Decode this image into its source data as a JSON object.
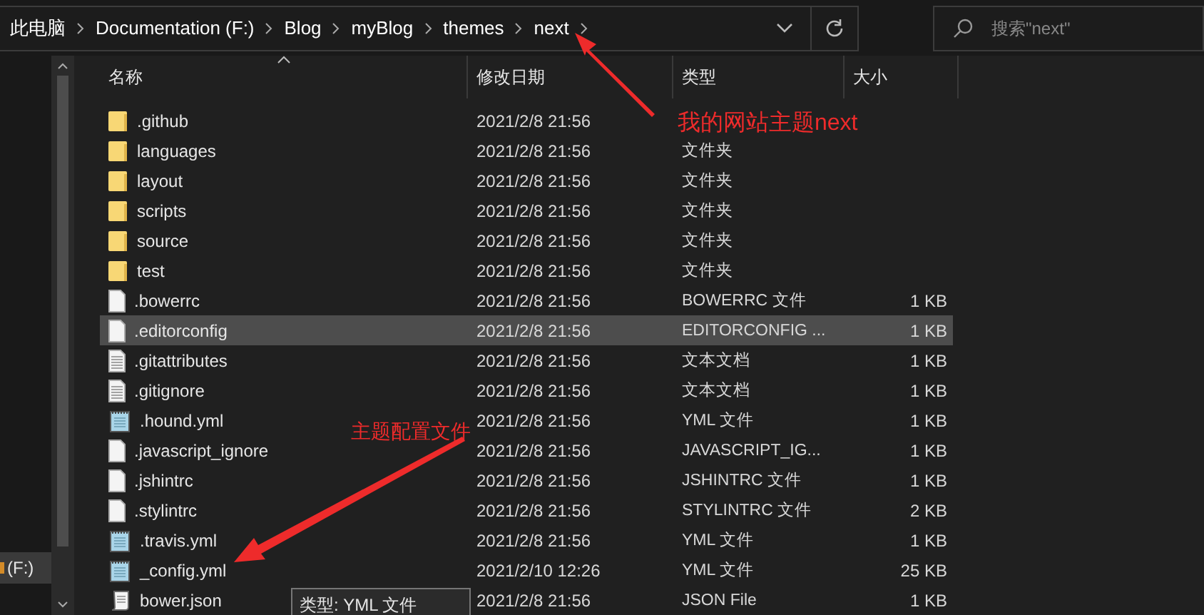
{
  "breadcrumbs": [
    "此电脑",
    "Documentation (F:)",
    "Blog",
    "myBlog",
    "themes",
    "next"
  ],
  "search": {
    "placeholder": "搜索\"next\""
  },
  "nav": {
    "items": [
      {
        "label": "(F:)",
        "selected": true
      }
    ]
  },
  "columns": [
    "名称",
    "修改日期",
    "类型",
    "大小"
  ],
  "files": [
    {
      "name": ".github",
      "date": "2021/2/8 21:56",
      "kind": "folder",
      "selected": false
    },
    {
      "name": "languages",
      "date": "2021/2/8 21:56",
      "type": "文件夹",
      "kind": "folder",
      "selected": false
    },
    {
      "name": "layout",
      "date": "2021/2/8 21:56",
      "type": "文件夹",
      "kind": "folder",
      "selected": false
    },
    {
      "name": "scripts",
      "date": "2021/2/8 21:56",
      "type": "文件夹",
      "kind": "folder",
      "selected": false
    },
    {
      "name": "source",
      "date": "2021/2/8 21:56",
      "type": "文件夹",
      "kind": "folder",
      "selected": false
    },
    {
      "name": "test",
      "date": "2021/2/8 21:56",
      "type": "文件夹",
      "kind": "folder",
      "selected": false
    },
    {
      "name": ".bowerrc",
      "date": "2021/2/8 21:56",
      "type": "BOWERRC 文件",
      "size": "1 KB",
      "kind": "file",
      "selected": false
    },
    {
      "name": ".editorconfig",
      "date": "2021/2/8 21:56",
      "type": "EDITORCONFIG ...",
      "size": "1 KB",
      "kind": "file",
      "selected": true
    },
    {
      "name": ".gitattributes",
      "date": "2021/2/8 21:56",
      "type": "文本文档",
      "size": "1 KB",
      "kind": "text",
      "selected": false
    },
    {
      "name": ".gitignore",
      "date": "2021/2/8 21:56",
      "type": "文本文档",
      "size": "1 KB",
      "kind": "text",
      "selected": false
    },
    {
      "name": ".hound.yml",
      "date": "2021/2/8 21:56",
      "type": "YML 文件",
      "size": "1 KB",
      "kind": "yml",
      "selected": false
    },
    {
      "name": ".javascript_ignore",
      "date": "2021/2/8 21:56",
      "type": "JAVASCRIPT_IG...",
      "size": "1 KB",
      "kind": "file",
      "selected": false
    },
    {
      "name": ".jshintrc",
      "date": "2021/2/8 21:56",
      "type": "JSHINTRC 文件",
      "size": "1 KB",
      "kind": "file",
      "selected": false
    },
    {
      "name": ".stylintrc",
      "date": "2021/2/8 21:56",
      "type": "STYLINTRC 文件",
      "size": "2 KB",
      "kind": "file",
      "selected": false
    },
    {
      "name": ".travis.yml",
      "date": "2021/2/8 21:56",
      "type": "YML 文件",
      "size": "1 KB",
      "kind": "yml",
      "selected": false
    },
    {
      "name": "_config.yml",
      "date": "2021/2/10 12:26",
      "type": "YML 文件",
      "size": "25 KB",
      "kind": "yml",
      "selected": false
    },
    {
      "name": "bower.json",
      "date": "2021/2/8 21:56",
      "type": "JSON File",
      "size": "1 KB",
      "kind": "script",
      "selected": false
    }
  ],
  "tooltip": "类型: YML 文件",
  "annotations": [
    {
      "text": "我的网站主题next"
    },
    {
      "text": "主题配置文件"
    }
  ]
}
